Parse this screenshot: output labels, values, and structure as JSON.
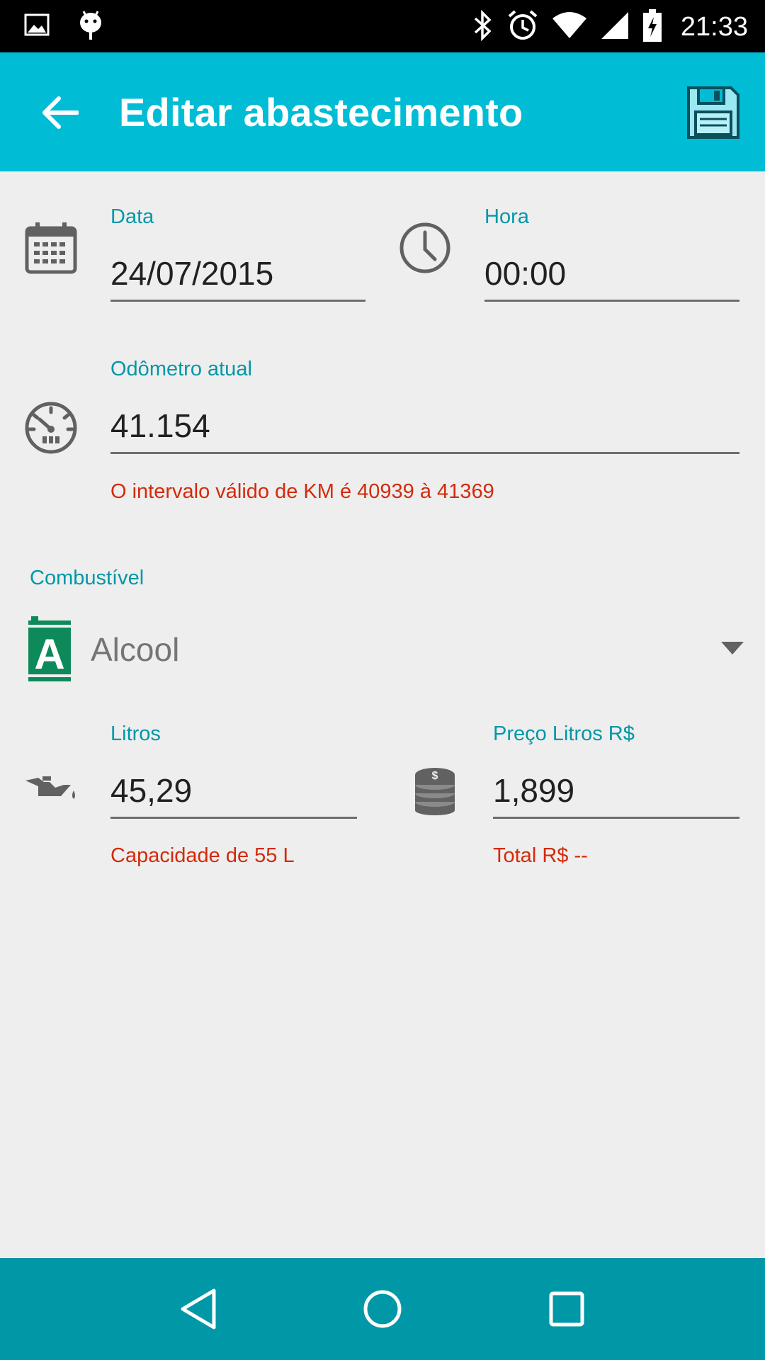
{
  "status_bar": {
    "time": "21:33",
    "icons": [
      "image-icon",
      "android-icon",
      "bluetooth-icon",
      "alarm-icon",
      "wifi-icon",
      "signal-icon",
      "battery-charging-icon"
    ]
  },
  "app_bar": {
    "title": "Editar abastecimento",
    "back_icon": "arrow-back-icon",
    "save_icon": "floppy-disk-icon"
  },
  "form": {
    "date": {
      "label": "Data",
      "value": "24/07/2015",
      "icon": "calendar-icon"
    },
    "time": {
      "label": "Hora",
      "value": "00:00",
      "icon": "clock-icon"
    },
    "odometer": {
      "label": "Odômetro atual",
      "value": "41.154",
      "error": "O intervalo válido de KM é 40939 à 41369",
      "icon": "speedometer-icon"
    },
    "fuel": {
      "label": "Combustível",
      "selected": "Alcool",
      "badge_letter": "A",
      "badge_color": "#0e8a5a",
      "icon": "fuel-can-icon"
    },
    "liters": {
      "label": "Litros",
      "value": "45,29",
      "helper": "Capacidade de 55 L",
      "icon": "oil-can-icon"
    },
    "price": {
      "label": "Preço Litros R$",
      "value": "1,899",
      "helper": "Total R$ --",
      "icon": "coins-icon"
    }
  },
  "nav_bar": {
    "icons": [
      "back-triangle-icon",
      "home-circle-icon",
      "recents-square-icon"
    ]
  },
  "colors": {
    "primary": "#00bcd4",
    "primary_dark": "#0097a7",
    "accent_text": "#0097a7",
    "error": "#d42a0a",
    "background": "#eeeeee"
  }
}
